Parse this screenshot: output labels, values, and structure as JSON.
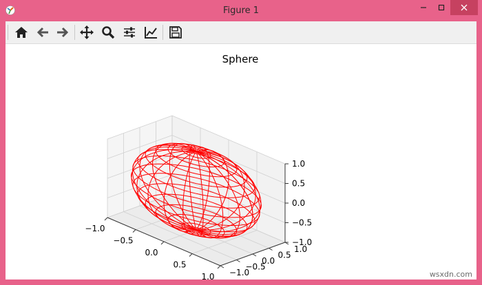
{
  "window": {
    "title": "Figure 1",
    "app_icon": "matplotlib-icon",
    "controls": [
      "minimize-icon",
      "maximize-icon",
      "close-icon"
    ]
  },
  "toolbar": {
    "buttons": [
      {
        "name": "home",
        "icon": "home-icon"
      },
      {
        "name": "back",
        "icon": "arrow-left-icon"
      },
      {
        "name": "forward",
        "icon": "arrow-right-icon"
      },
      {
        "name": "pan",
        "icon": "move-icon"
      },
      {
        "name": "zoom",
        "icon": "zoom-icon"
      },
      {
        "name": "configure-subplots",
        "icon": "sliders-icon"
      },
      {
        "name": "edit-axis",
        "icon": "chart-line-icon"
      },
      {
        "name": "save",
        "icon": "floppy-icon"
      }
    ]
  },
  "chart_data": {
    "type": "3d-wireframe",
    "title": "Sphere",
    "series": [
      {
        "shape": "sphere",
        "center": [
          0,
          0,
          0
        ],
        "radius": 1,
        "color": "#ff0000"
      }
    ],
    "xlim": [
      -1.0,
      1.0
    ],
    "ylim": [
      -1.0,
      1.0
    ],
    "zlim": [
      -1.0,
      1.0
    ],
    "x_ticks": [
      "−1.0",
      "−0.5",
      "0.0",
      "0.5",
      "1.0"
    ],
    "y_ticks": [
      "−1.0",
      "−0.5",
      "0.0",
      "0.5",
      "1.0"
    ],
    "z_ticks": [
      "−1.0",
      "−0.5",
      "0.0",
      "0.5",
      "1.0"
    ],
    "grid": true,
    "pane_color": "#f2f2f2",
    "grid_color": "#d0d0d0"
  },
  "watermark": "wsxdn.com"
}
